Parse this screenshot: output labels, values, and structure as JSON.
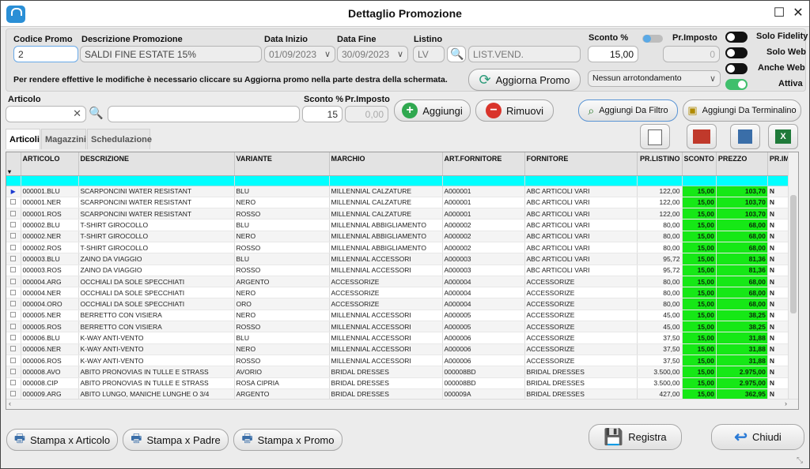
{
  "window": {
    "title": "Dettaglio Promozione"
  },
  "header": {
    "codice_label": "Codice Promo",
    "codice_value": "2",
    "descr_label": "Descrizione Promozione",
    "descr_value": "SALDI FINE ESTATE 15%",
    "data_inizio_label": "Data Inizio",
    "data_inizio_value": "01/09/2023",
    "data_fine_label": "Data Fine",
    "data_fine_value": "30/09/2023",
    "listino_label": "Listino",
    "listino_code": "LV",
    "listino_name": "LIST.VEND.",
    "sconto_label": "Sconto %",
    "sconto_value": "15,00",
    "primposto_label": "Pr.Imposto",
    "primposto_value": "0",
    "notice": "Per rendere effettive le modifiche è necessario cliccare su Aggiorna promo nella parte destra della schermata.",
    "aggiorna_label": "Aggiorna Promo",
    "arrotondamento": "Nessun arrotondamento",
    "toggles": [
      {
        "label": "Solo Fidelity",
        "on": false
      },
      {
        "label": "Solo Web",
        "on": false
      },
      {
        "label": "Anche Web",
        "on": false
      },
      {
        "label": "Attiva",
        "on": true
      }
    ]
  },
  "articolo_bar": {
    "articolo_label": "Articolo",
    "sconto_label": "Sconto %",
    "primposto_label": "Pr.Imposto",
    "sconto_value": "15",
    "primposto_value": "0,00",
    "aggiungi_label": "Aggiungi",
    "rimuovi_label": "Rimuovi",
    "filtro_label": "Aggiungi Da Filtro",
    "terminalino_label": "Aggiungi Da Terminalino"
  },
  "tabs": [
    "Articoli",
    "Magazzini",
    "Schedulazione"
  ],
  "table": {
    "columns": [
      "ARTICOLO",
      "DESCRIZIONE",
      "VARIANTE",
      "MARCHIO",
      "ART.FORNITORE",
      "FORNITORE",
      "PR.LISTINO",
      "SCONTO",
      "PREZZO",
      "PR.IM"
    ],
    "rows": [
      [
        "000001.BLU",
        "SCARPONCINI WATER RESISTANT",
        "BLU",
        "MILLENNIAL CALZATURE",
        "A000001",
        "ABC ARTICOLI VARI",
        "122,00",
        "15,00",
        "103,70",
        "N"
      ],
      [
        "000001.NER",
        "SCARPONCINI WATER RESISTANT",
        "NERO",
        "MILLENNIAL CALZATURE",
        "A000001",
        "ABC ARTICOLI VARI",
        "122,00",
        "15,00",
        "103,70",
        "N"
      ],
      [
        "000001.ROS",
        "SCARPONCINI WATER RESISTANT",
        "ROSSO",
        "MILLENNIAL CALZATURE",
        "A000001",
        "ABC ARTICOLI VARI",
        "122,00",
        "15,00",
        "103,70",
        "N"
      ],
      [
        "000002.BLU",
        "T-SHIRT GIROCOLLO",
        "BLU",
        "MILLENNIAL ABBIGLIAMENTO",
        "A000002",
        "ABC ARTICOLI VARI",
        "80,00",
        "15,00",
        "68,00",
        "N"
      ],
      [
        "000002.NER",
        "T-SHIRT GIROCOLLO",
        "NERO",
        "MILLENNIAL ABBIGLIAMENTO",
        "A000002",
        "ABC ARTICOLI VARI",
        "80,00",
        "15,00",
        "68,00",
        "N"
      ],
      [
        "000002.ROS",
        "T-SHIRT GIROCOLLO",
        "ROSSO",
        "MILLENNIAL ABBIGLIAMENTO",
        "A000002",
        "ABC ARTICOLI VARI",
        "80,00",
        "15,00",
        "68,00",
        "N"
      ],
      [
        "000003.BLU",
        "ZAINO DA VIAGGIO",
        "BLU",
        "MILLENNIAL ACCESSORI",
        "A000003",
        "ABC ARTICOLI VARI",
        "95,72",
        "15,00",
        "81,36",
        "N"
      ],
      [
        "000003.ROS",
        "ZAINO DA VIAGGIO",
        "ROSSO",
        "MILLENNIAL ACCESSORI",
        "A000003",
        "ABC ARTICOLI VARI",
        "95,72",
        "15,00",
        "81,36",
        "N"
      ],
      [
        "000004.ARG",
        "OCCHIALI DA SOLE SPECCHIATI",
        "ARGENTO",
        "ACCESSORIZE",
        "A000004",
        "ACCESSORIZE",
        "80,00",
        "15,00",
        "68,00",
        "N"
      ],
      [
        "000004.NER",
        "OCCHIALI DA SOLE SPECCHIATI",
        "NERO",
        "ACCESSORIZE",
        "A000004",
        "ACCESSORIZE",
        "80,00",
        "15,00",
        "68,00",
        "N"
      ],
      [
        "000004.ORO",
        "OCCHIALI DA SOLE SPECCHIATI",
        "ORO",
        "ACCESSORIZE",
        "A000004",
        "ACCESSORIZE",
        "80,00",
        "15,00",
        "68,00",
        "N"
      ],
      [
        "000005.NER",
        "BERRETTO CON VISIERA",
        "NERO",
        "MILLENNIAL ACCESSORI",
        "A000005",
        "ACCESSORIZE",
        "45,00",
        "15,00",
        "38,25",
        "N"
      ],
      [
        "000005.ROS",
        "BERRETTO CON VISIERA",
        "ROSSO",
        "MILLENNIAL ACCESSORI",
        "A000005",
        "ACCESSORIZE",
        "45,00",
        "15,00",
        "38,25",
        "N"
      ],
      [
        "000006.BLU",
        "K-WAY ANTI-VENTO",
        "BLU",
        "MILLENNIAL ACCESSORI",
        "A000006",
        "ACCESSORIZE",
        "37,50",
        "15,00",
        "31,88",
        "N"
      ],
      [
        "000006.NER",
        "K-WAY ANTI-VENTO",
        "NERO",
        "MILLENNIAL ACCESSORI",
        "A000006",
        "ACCESSORIZE",
        "37,50",
        "15,00",
        "31,88",
        "N"
      ],
      [
        "000006.ROS",
        "K-WAY ANTI-VENTO",
        "ROSSO",
        "MILLENNIAL ACCESSORI",
        "A000006",
        "ACCESSORIZE",
        "37,50",
        "15,00",
        "31,88",
        "N"
      ],
      [
        "000008.AVO",
        "ABITO PRONOVIAS IN TULLE E STRASS",
        "AVORIO",
        "BRIDAL DRESSES",
        "000008BD",
        "BRIDAL DRESSES",
        "3.500,00",
        "15,00",
        "2.975,00",
        "N"
      ],
      [
        "000008.CIP",
        "ABITO PRONOVIAS IN TULLE E STRASS",
        "ROSA CIPRIA",
        "BRIDAL DRESSES",
        "000008BD",
        "BRIDAL DRESSES",
        "3.500,00",
        "15,00",
        "2.975,00",
        "N"
      ],
      [
        "000009.ARG",
        "ABITO LUNGO, MANICHE LUNGHE O 3/4",
        "ARGENTO",
        "BRIDAL DRESSES",
        "000009A",
        "BRIDAL DRESSES",
        "427,00",
        "15,00",
        "362,95",
        "N"
      ]
    ]
  },
  "footer": {
    "stampa_articolo": "Stampa x Articolo",
    "stampa_padre": "Stampa x Padre",
    "stampa_promo": "Stampa x Promo",
    "registra": "Registra",
    "chiudi": "Chiudi"
  },
  "colors": {
    "accent": "#2a8fd6",
    "highlight": "#16e816",
    "filter_row": "#00ffff"
  }
}
